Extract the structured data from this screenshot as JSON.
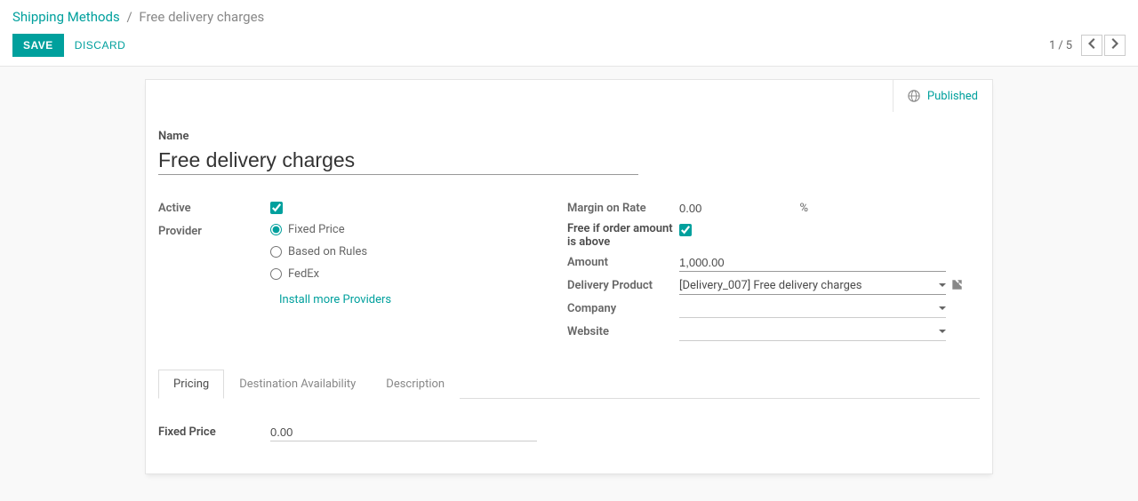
{
  "breadcrumb": {
    "parent": "Shipping Methods",
    "current": "Free delivery charges"
  },
  "actions": {
    "save": "SAVE",
    "discard": "DISCARD"
  },
  "pager": {
    "current": "1",
    "total": "5"
  },
  "header_status": "Published",
  "form": {
    "name_label": "Name",
    "name_value": "Free delivery charges",
    "left": {
      "active_label": "Active",
      "active_checked": true,
      "provider_label": "Provider",
      "provider_options": {
        "fixed": "Fixed Price",
        "rules": "Based on Rules",
        "fedex": "FedEx"
      },
      "install_more": "Install more Providers"
    },
    "right": {
      "margin_label": "Margin on Rate",
      "margin_value": "0.00",
      "margin_unit": "%",
      "free_label": "Free if order amount is above",
      "free_checked": true,
      "amount_label": "Amount",
      "amount_value": "1,000.00",
      "delivery_product_label": "Delivery Product",
      "delivery_product_value": "[Delivery_007] Free delivery charges",
      "company_label": "Company",
      "company_value": "",
      "website_label": "Website",
      "website_value": ""
    }
  },
  "tabs": {
    "pricing": "Pricing",
    "destination": "Destination Availability",
    "description": "Description"
  },
  "pricing_tab": {
    "fixed_price_label": "Fixed Price",
    "fixed_price_value": "0.00"
  }
}
